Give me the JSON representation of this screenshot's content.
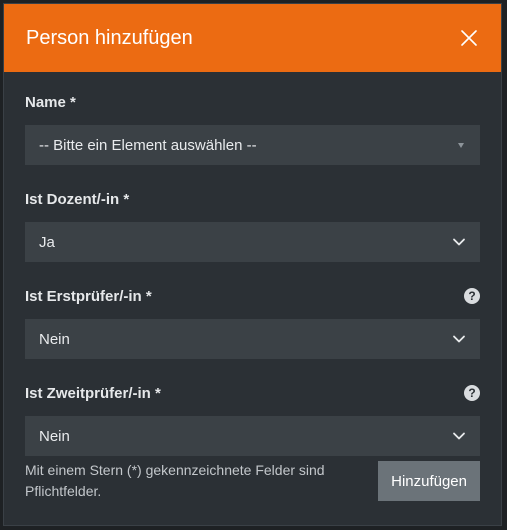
{
  "modal": {
    "title": "Person hinzufügen",
    "close_icon": "close-icon"
  },
  "fields": [
    {
      "label": "Name *",
      "value": "-- Bitte ein Element auswählen --",
      "has_help": false
    },
    {
      "label": "Ist Dozent/-in *",
      "value": "Ja",
      "has_help": false
    },
    {
      "label": "Ist Erstprüfer/-in *",
      "value": "Nein",
      "has_help": true
    },
    {
      "label": "Ist Zweitprüfer/-in *",
      "value": "Nein",
      "has_help": true
    }
  ],
  "footer": {
    "note": "Mit einem Stern (*) gekennzeichnete Felder sind Pflichtfelder.",
    "submit_label": "Hinzufügen"
  },
  "help_icon_glyph": "?",
  "colors": {
    "header": "#ec6b12",
    "modal_bg": "#2b3035",
    "field_bg": "#3b4146",
    "button_bg": "#6b7379"
  }
}
